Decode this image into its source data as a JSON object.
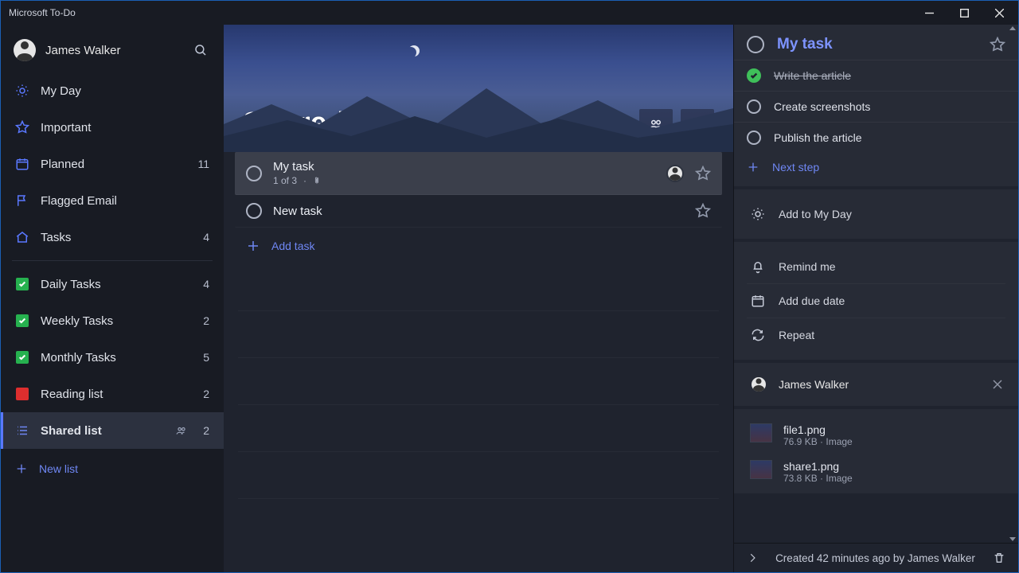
{
  "app_title": "Microsoft To-Do",
  "profile": {
    "name": "James Walker"
  },
  "smart_lists": [
    {
      "label": "My Day",
      "count": ""
    },
    {
      "label": "Important",
      "count": ""
    },
    {
      "label": "Planned",
      "count": "11"
    },
    {
      "label": "Flagged Email",
      "count": ""
    },
    {
      "label": "Tasks",
      "count": "4"
    }
  ],
  "lists": [
    {
      "label": "Daily Tasks",
      "count": "4",
      "icon": "green"
    },
    {
      "label": "Weekly Tasks",
      "count": "2",
      "icon": "green"
    },
    {
      "label": "Monthly Tasks",
      "count": "5",
      "icon": "green"
    },
    {
      "label": "Reading list",
      "count": "2",
      "icon": "red"
    },
    {
      "label": "Shared list",
      "count": "2",
      "icon": "lines",
      "shared": true,
      "active": true
    }
  ],
  "new_list_label": "New list",
  "hero": {
    "title": "Shared list"
  },
  "tasks": [
    {
      "title": "My task",
      "sub": "1 of 3",
      "has_attachment": true,
      "selected": true,
      "assigned": true
    },
    {
      "title": "New task"
    }
  ],
  "add_task_label": "Add task",
  "detail": {
    "title": "My task",
    "steps": [
      {
        "label": "Write the article",
        "done": true
      },
      {
        "label": "Create screenshots",
        "done": false
      },
      {
        "label": "Publish the article",
        "done": false
      }
    ],
    "next_step_label": "Next step",
    "add_my_day_label": "Add to My Day",
    "remind_label": "Remind me",
    "due_label": "Add due date",
    "repeat_label": "Repeat",
    "assignee": "James Walker",
    "attachments": [
      {
        "name": "file1.png",
        "meta": "76.9 KB · Image"
      },
      {
        "name": "share1.png",
        "meta": "73.8 KB · Image"
      }
    ],
    "footer": "Created 42 minutes ago by James Walker"
  }
}
